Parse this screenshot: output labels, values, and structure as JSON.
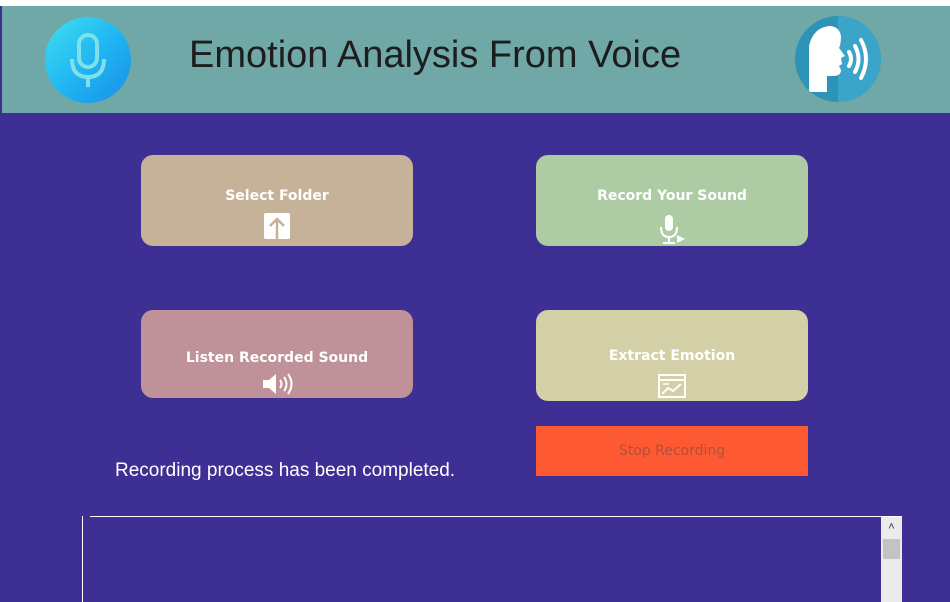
{
  "header": {
    "title": "Emotion Analysis From Voice",
    "left_icon": "microphone-icon",
    "right_icon": "speaking-head-icon",
    "background": "#6fa8a6"
  },
  "buttons": {
    "select_folder": {
      "label": "Select Folder",
      "icon": "upload-icon",
      "color": "#c6b299"
    },
    "record_sound": {
      "label": "Record Your Sound",
      "icon": "microphone-play-icon",
      "color": "#adcca3"
    },
    "listen_sound": {
      "label": "Listen Recorded Sound",
      "icon": "speaker-icon",
      "color": "#be9298"
    },
    "extract_emotion": {
      "label": "Extract Emotion",
      "icon": "chart-window-icon",
      "color": "#d3cfa6"
    },
    "stop_recording": {
      "label": "Stop Recording",
      "color": "#fd5a34"
    }
  },
  "status": {
    "message": "Recording process has been completed."
  },
  "output_box": {
    "value": ""
  },
  "colors": {
    "background": "#3d2f93"
  }
}
